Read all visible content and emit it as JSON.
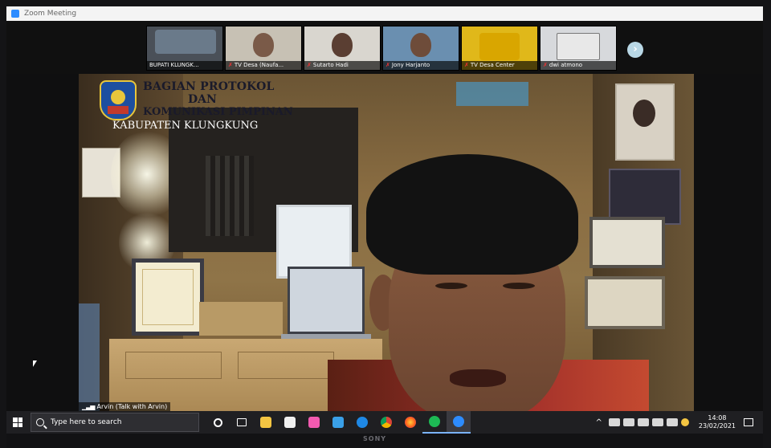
{
  "window": {
    "title": "Zoom Meeting"
  },
  "participants": [
    {
      "name": "BUPATI KLUNGK...",
      "muted": false
    },
    {
      "name": "TV Desa (Naufa...",
      "muted": true
    },
    {
      "name": "Sutarto Hadi",
      "muted": true
    },
    {
      "name": "Jony Harjanto",
      "muted": true
    },
    {
      "name": "TV Desa Center",
      "muted": true
    },
    {
      "name": "dwi atmono",
      "muted": true
    }
  ],
  "next_icon": "chevron-right-icon",
  "overlay": {
    "line1": "BAGIAN PROTOKOL",
    "line2": "DAN",
    "line3": "KOMUNIKASI PIMPINAN",
    "line4": "KABUPATEN KLUNGKUNG"
  },
  "speaker": {
    "label": "Arvin (Talk with Arvin)"
  },
  "taskbar": {
    "search_placeholder": "Type here to search",
    "apps": [
      "cortana",
      "task-view",
      "file-explorer",
      "store",
      "photos",
      "mail",
      "edge",
      "chrome",
      "firefox",
      "spotify",
      "zoom"
    ],
    "time": "14:08",
    "date": "23/02/2021"
  },
  "brand": "SONY",
  "colors": {
    "zoom_blue": "#2d8cff",
    "taskbar_bg": "#1f1f22",
    "mute_red": "#ee3333"
  }
}
